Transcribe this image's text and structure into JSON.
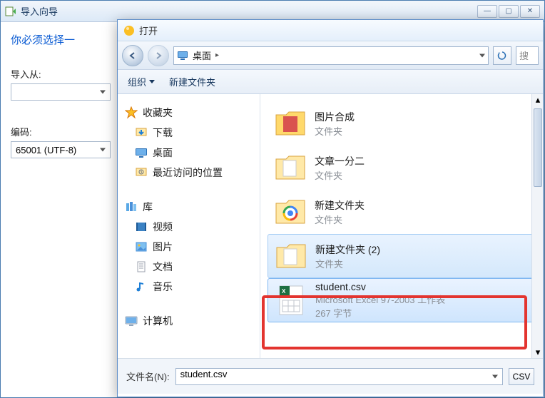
{
  "back_window": {
    "title": "导入向导",
    "hint": "你必须选择一",
    "import_from_label": "导入从:",
    "encoding_label": "编码:",
    "encoding_value": "65001 (UTF-8)"
  },
  "open_dialog": {
    "title": "打开",
    "address": "桌面",
    "address_arrow": "▸",
    "search_placeholder": "搜",
    "organize_label": "组织",
    "new_folder_label": "新建文件夹",
    "sidebar": {
      "favorites": {
        "label": "收藏夹",
        "items": [
          {
            "label": "下载"
          },
          {
            "label": "桌面"
          },
          {
            "label": "最近访问的位置"
          }
        ]
      },
      "libraries": {
        "label": "库",
        "items": [
          {
            "label": "视频"
          },
          {
            "label": "图片"
          },
          {
            "label": "文档"
          },
          {
            "label": "音乐"
          }
        ]
      },
      "computer": {
        "label": "计算机"
      }
    },
    "files": [
      {
        "name": "图片合成",
        "sub": "文件夹",
        "type": "folder-red"
      },
      {
        "name": "文章一分二",
        "sub": "文件夹",
        "type": "folder"
      },
      {
        "name": "新建文件夹",
        "sub": "文件夹",
        "type": "folder-chrome"
      },
      {
        "name": "新建文件夹 (2)",
        "sub": "文件夹",
        "type": "folder",
        "selected": true
      },
      {
        "name": "student.csv",
        "sub": "Microsoft Excel 97-2003 工作表",
        "sub2": "267 字节",
        "type": "csv",
        "highlighted": true
      }
    ],
    "filename_label": "文件名(N):",
    "filename_value": "student.csv",
    "filetype_button": "CSV"
  }
}
